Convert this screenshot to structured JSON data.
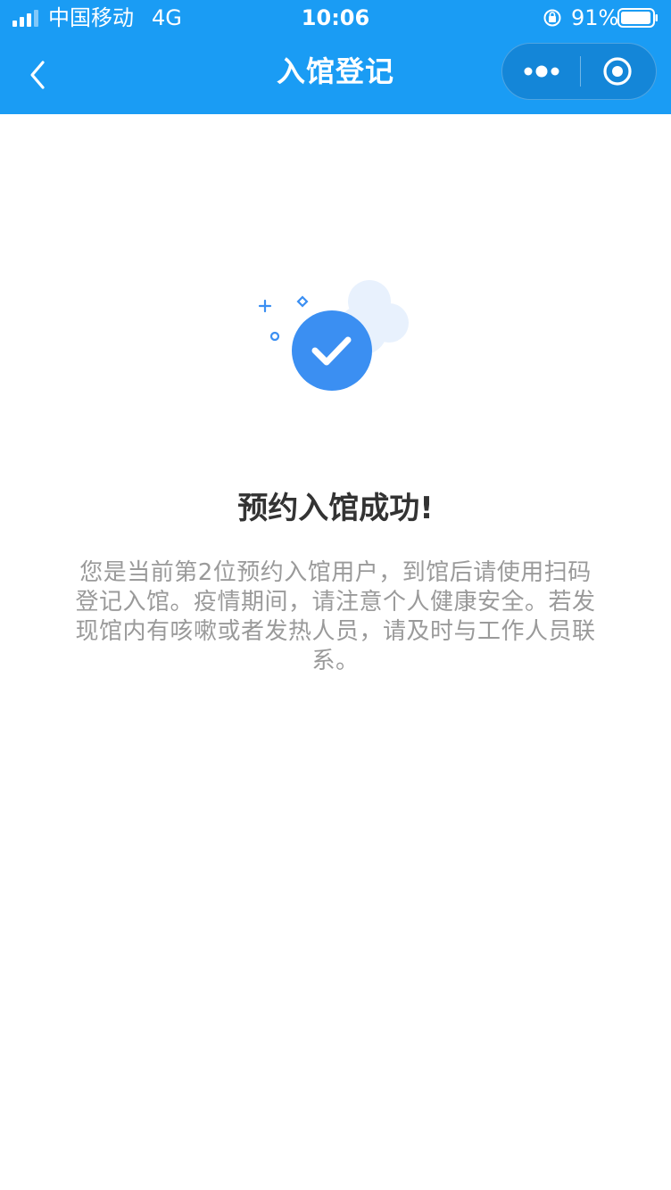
{
  "status_bar": {
    "carrier": "中国移动",
    "network": "4G",
    "time": "10:06",
    "battery_percent": "91%",
    "icons": [
      "signal-icon",
      "orientation-lock-icon",
      "battery-icon"
    ]
  },
  "nav_bar": {
    "title": "入馆登记",
    "back_icon": "chevron-left-icon",
    "more_icon": "more-dots-icon",
    "close_icon": "target-close-icon"
  },
  "main": {
    "illustration_icon": "checkmark-circle-icon",
    "title": "预约入馆成功!",
    "description": "您是当前第2位预约入馆用户，到馆后请使用扫码登记入馆。疫情期间，请注意个人健康安全。若发现馆内有咳嗽或者发热人员，请及时与工作人员联系。"
  },
  "colors": {
    "header_bg": "#1a9cf4",
    "accent": "#3b8ff2",
    "title_text": "#333333",
    "desc_text": "#9a9a9a"
  }
}
